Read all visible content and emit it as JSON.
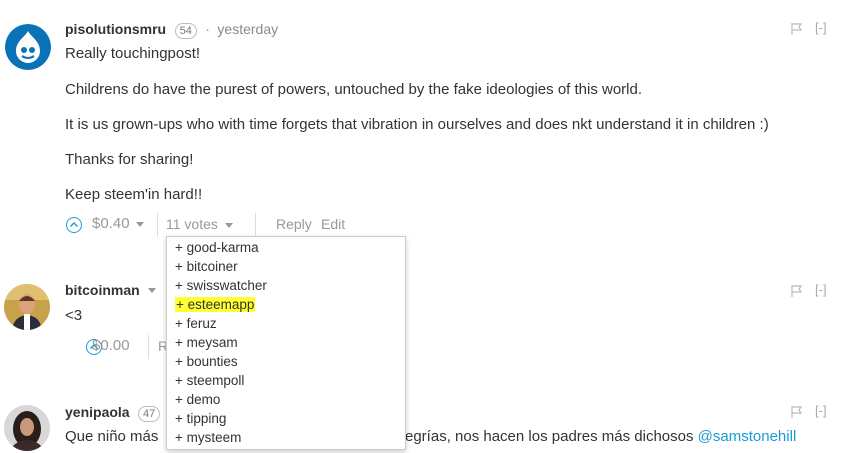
{
  "comments": [
    {
      "author": "pisolutionsmru",
      "reputation": "54",
      "time": "yesterday",
      "paragraphs": [
        "Really touchingpost!",
        "Childrens do have the purest of powers, untouched by the fake ideologies of this world.",
        "It is us grown-ups who with time forgets that vibration in ourselves and does nkt understand it in children :)",
        "Thanks for sharing!",
        "Keep steem'in hard!!"
      ],
      "payout": "$0.40",
      "votes": "11 votes",
      "reply": "Reply",
      "edit": "Edit",
      "collapse": "[-]"
    },
    {
      "author": "bitcoinman",
      "body": "<3",
      "payout": "$0.00",
      "reply_partial": "R",
      "collapse": "[-]"
    },
    {
      "author": "yenipaola",
      "reputation_partial": "47",
      "body_left": "Que niño más",
      "body_right": "egrías, nos hacen los padres más dichosos",
      "mention": "@samstonehill",
      "collapse": "[-]"
    }
  ],
  "voters": [
    "+ good-karma",
    "+ bitcoiner",
    "+ swisswatcher",
    "+ esteemapp",
    "+ feruz",
    "+ meysam",
    "+ bounties",
    "+ steempoll",
    "+ demo",
    "+ tipping",
    "+ mysteem"
  ],
  "highlighted_voter_index": 3,
  "colors": {
    "accent": "#1a9ad6",
    "highlight": "#ffff33"
  }
}
